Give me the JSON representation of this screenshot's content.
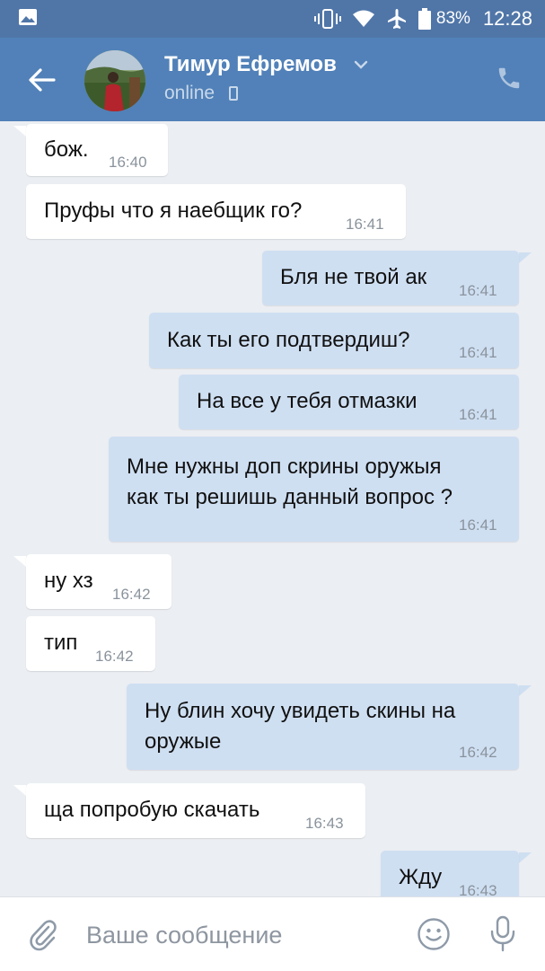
{
  "status_bar": {
    "battery_percent": "83%",
    "time": "12:28",
    "icons": [
      "gallery-icon",
      "vibrate-icon",
      "wifi-icon",
      "airplane-icon",
      "battery-icon"
    ]
  },
  "header": {
    "contact_name": "Тимур Ефремов",
    "status": "online",
    "icons": [
      "back-arrow-icon",
      "chevron-down-icon",
      "mobile-icon",
      "phone-icon"
    ]
  },
  "messages": [
    {
      "direction": "in",
      "text": "бож.",
      "time": "16:40"
    },
    {
      "direction": "in",
      "text": "Пруфы что я наебщик го?",
      "time": "16:41"
    },
    {
      "direction": "out",
      "text": "Бля не твой ак",
      "time": "16:41"
    },
    {
      "direction": "out",
      "text": "Как ты его подтвердиш?",
      "time": "16:41"
    },
    {
      "direction": "out",
      "text": "На все у тебя отмазки",
      "time": "16:41"
    },
    {
      "direction": "out",
      "line1": "Мне нужны доп скрины оружыя",
      "line2": "как ты решишь данный вопрос ?",
      "time": "16:41"
    },
    {
      "direction": "in",
      "text": "ну хз",
      "time": "16:42"
    },
    {
      "direction": "in",
      "text": "тип",
      "time": "16:42"
    },
    {
      "direction": "out",
      "line1": "Ну блин хочу увидеть скины на",
      "line2": "оружые",
      "time": "16:42"
    },
    {
      "direction": "in",
      "text": "ща попробую скачать",
      "time": "16:43"
    },
    {
      "direction": "out",
      "text": "Жду",
      "time": "16:43"
    }
  ],
  "composer": {
    "placeholder": "Ваше сообщение",
    "icons": [
      "paperclip-icon",
      "emoji-icon",
      "microphone-icon"
    ]
  },
  "colors": {
    "header": "#5181b8",
    "status_bar": "#5076a8",
    "chat_background": "#ebeef2",
    "incoming_bubble": "#ffffff",
    "outgoing_bubble": "#cfdff2"
  }
}
